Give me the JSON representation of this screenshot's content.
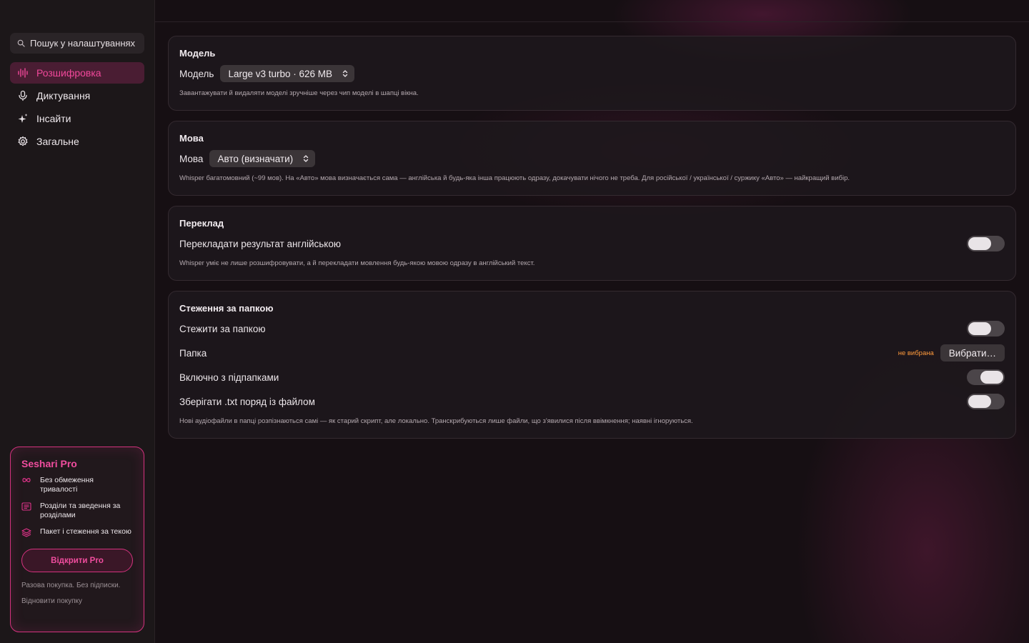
{
  "sidebar": {
    "search_placeholder": "Пошук у налаштуваннях",
    "items": [
      {
        "label": "Розшифровка",
        "icon": "waveform-icon",
        "active": true
      },
      {
        "label": "Диктування",
        "icon": "microphone-icon",
        "active": false
      },
      {
        "label": "Інсайти",
        "icon": "sparkles-icon",
        "active": false
      },
      {
        "label": "Загальне",
        "icon": "gear-icon",
        "active": false
      }
    ],
    "pro": {
      "title": "Seshari Pro",
      "features": [
        {
          "icon": "infinity-icon",
          "text": "Без обмеження тривалості"
        },
        {
          "icon": "document-text-icon",
          "text": "Розділи та зведення за розділами"
        },
        {
          "icon": "layers-icon",
          "text": "Пакет і стеження за текою"
        }
      ],
      "button": "Відкрити Pro",
      "note": "Разова покупка. Без підписки.",
      "restore": "Відновити покупку"
    }
  },
  "sections": {
    "model": {
      "title": "Модель",
      "label": "Модель",
      "value": "Large v3 turbo · 626 MB",
      "note": "Завантажувати й видаляти моделі зручніше через чип моделі в шапці вікна."
    },
    "language": {
      "title": "Мова",
      "label": "Мова",
      "value": "Авто (визначати)",
      "note": "Whisper багатомовний (~99 мов). На «Авто» мова визначається сама — англійська й будь-яка інша працюють одразу, докачувати нічого не треба. Для російської / української / суржику «Авто» — найкращий вибір."
    },
    "translation": {
      "title": "Переклад",
      "label": "Перекладати результат англійською",
      "enabled": false,
      "note": "Whisper уміє не лише розшифровувати, а й перекладати мовлення будь-якою мовою одразу в англійський текст."
    },
    "folder": {
      "title": "Стеження за папкою",
      "watch_label": "Стежити за папкою",
      "watch_enabled": false,
      "folder_label": "Папка",
      "folder_status": "не вибрана",
      "choose_button": "Вибрати…",
      "subfolders_label": "Включно з підпапками",
      "subfolders_enabled": true,
      "save_txt_label": "Зберігати .txt поряд із файлом",
      "save_txt_enabled": false,
      "note": "Нові аудіофайли в папці розпізнаються самі — як старий скрипт, але локально. Транскрибуються лише файли, що з'явилися після ввімкнення; наявні ігноруються."
    }
  },
  "colors": {
    "accent": "#f0489a",
    "active_bg": "#4a1d33",
    "warning": "#ff9a3c"
  }
}
